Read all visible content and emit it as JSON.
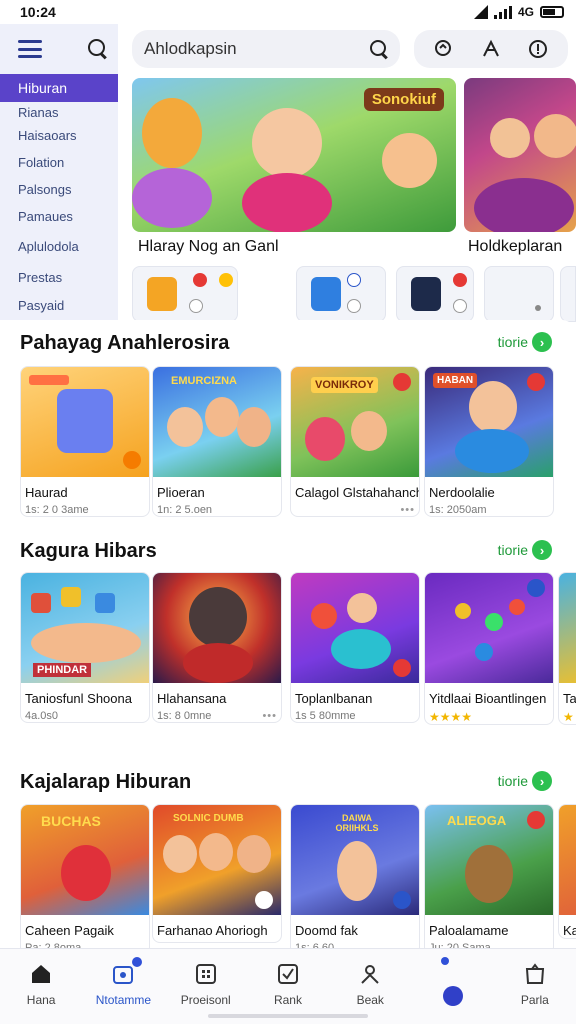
{
  "status_bar": {
    "time": "10:24",
    "network": "4G"
  },
  "sidebar": {
    "active_item": "Hiburan",
    "items": [
      "Rianas",
      "Haisaoars",
      "Folation",
      "Palsongs",
      "Pamaues",
      "Aplulodola",
      "Prestas",
      "Pasyaid"
    ]
  },
  "search": {
    "placeholder": "Ahlodkapsin"
  },
  "hero": {
    "left_title": "Hlaray Nog an Ganl",
    "left_banner_text": "Sonokiuf",
    "right_title": "Holdkeplaran"
  },
  "sections": [
    {
      "title": "Pahayag Anahlerosira",
      "more": "tiorie",
      "cards": [
        {
          "title": "Haurad",
          "sub": "1s: 2 0 3ame",
          "tag": ""
        },
        {
          "title": "Plioeran",
          "sub": "1n: 2 5.oen",
          "banner": "EMURCIZNA"
        },
        {
          "title": "Calagol Glstahahanch",
          "sub": "",
          "banner": "VONIKROY"
        },
        {
          "title": "Nerdoolalie",
          "sub": "1s: 2050am",
          "banner": "HABAN"
        }
      ]
    },
    {
      "title": "Kagura Hibars",
      "more": "tiorie",
      "cards": [
        {
          "title": "Taniosfunl Shoona",
          "sub": "4a.0s0",
          "banner": "PHINDAR"
        },
        {
          "title": "Hlahansana",
          "sub": "1s: 8 0mne"
        },
        {
          "title": "Toplanlbanan",
          "sub": "1s 5 80mme"
        },
        {
          "title": "Yitdlaai Bioantlingen",
          "sub": ""
        },
        {
          "title": "Ta",
          "sub": ""
        }
      ]
    },
    {
      "title": "Kajalarap Hiburan",
      "more": "tiorie",
      "cards": [
        {
          "title": "Caheen Pagaik",
          "sub": "Pa: 2 8oma",
          "banner": "BUCHAS"
        },
        {
          "title": "Farhanao Ahoriogh",
          "sub": "",
          "banner": "SOLNIC DUMB"
        },
        {
          "title": "Doomd fak",
          "sub": "1s: 6 60",
          "banner": "DAIWA ORIIHKLS"
        },
        {
          "title": "Paloalamame",
          "sub": "Ju: 20 Sama",
          "banner": "ALIEOGA"
        },
        {
          "title": "Ka",
          "sub": ""
        }
      ]
    }
  ],
  "bottom_nav": [
    {
      "label": "Hana",
      "icon": "home-icon"
    },
    {
      "label": "Ntotamme",
      "icon": "apps-icon"
    },
    {
      "label": "Proeisonl",
      "icon": "grid-icon"
    },
    {
      "label": "Rank",
      "icon": "rank-icon"
    },
    {
      "label": "Beak",
      "icon": "profile-icon"
    },
    {
      "label": "",
      "icon": "dot-icon"
    },
    {
      "label": "Parla",
      "icon": "bag-icon"
    }
  ],
  "colors": {
    "accent": "#5a43c9",
    "more_green": "#2cc04f",
    "nav_active": "#2a55c9"
  }
}
